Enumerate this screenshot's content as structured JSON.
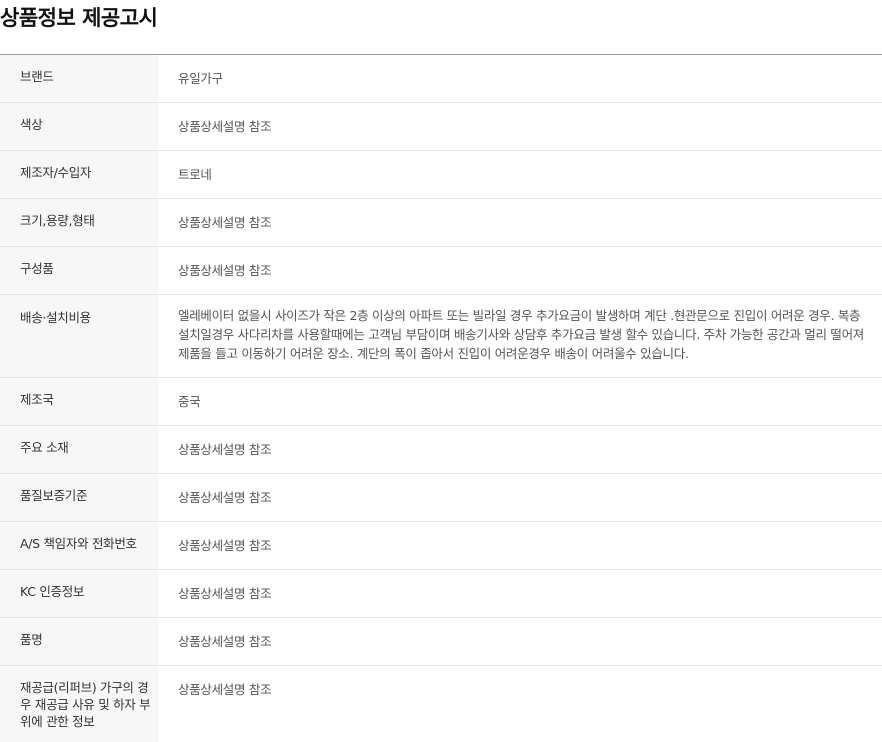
{
  "page": {
    "title": "상품정보 제공고시"
  },
  "rows": [
    {
      "label": "브랜드",
      "value": "유일가구"
    },
    {
      "label": "색상",
      "value": "상품상세설명 참조"
    },
    {
      "label": "제조자/수입자",
      "value": "트로네"
    },
    {
      "label": "크기,용량,형태",
      "value": "상품상세설명 참조"
    },
    {
      "label": "구성품",
      "value": "상품상세설명 참조"
    },
    {
      "label": "배송·설치비용",
      "value": "엘레베이터 없을시 사이즈가 작은 2층 이상의 아파트 또는 빌라일 경우 추가요금이 발생하며 계단 .현관문으로 진입이 어려운 경우. 복층 설치일경우 사다리차를 사용할때에는 고객님 부담이며 배송기사와 상담후 추가요금 발생 할수 있습니다. 주차 가능한 공간과 멀리 떨어져 제품을 들고 이동하기 어려운 장소. 계단의 폭이 좁아서 진입이 어려운경우 배송이 어려울수 있습니다."
    },
    {
      "label": "제조국",
      "value": "중국"
    },
    {
      "label": "주요 소재",
      "value": "상품상세설명 참조"
    },
    {
      "label": "품질보증기준",
      "value": "상품상세설명 참조"
    },
    {
      "label": "A/S 책임자와 전화번호",
      "value": "상품상세설명 참조"
    },
    {
      "label": "KC 인증정보",
      "value": "상품상세설명 참조"
    },
    {
      "label": "품명",
      "value": "상품상세설명 참조"
    },
    {
      "label": "재공급(리퍼브) 가구의 경우 재공급 사유 및 하자 부위에 관한 정보",
      "value": "상품상세설명 참조"
    }
  ]
}
